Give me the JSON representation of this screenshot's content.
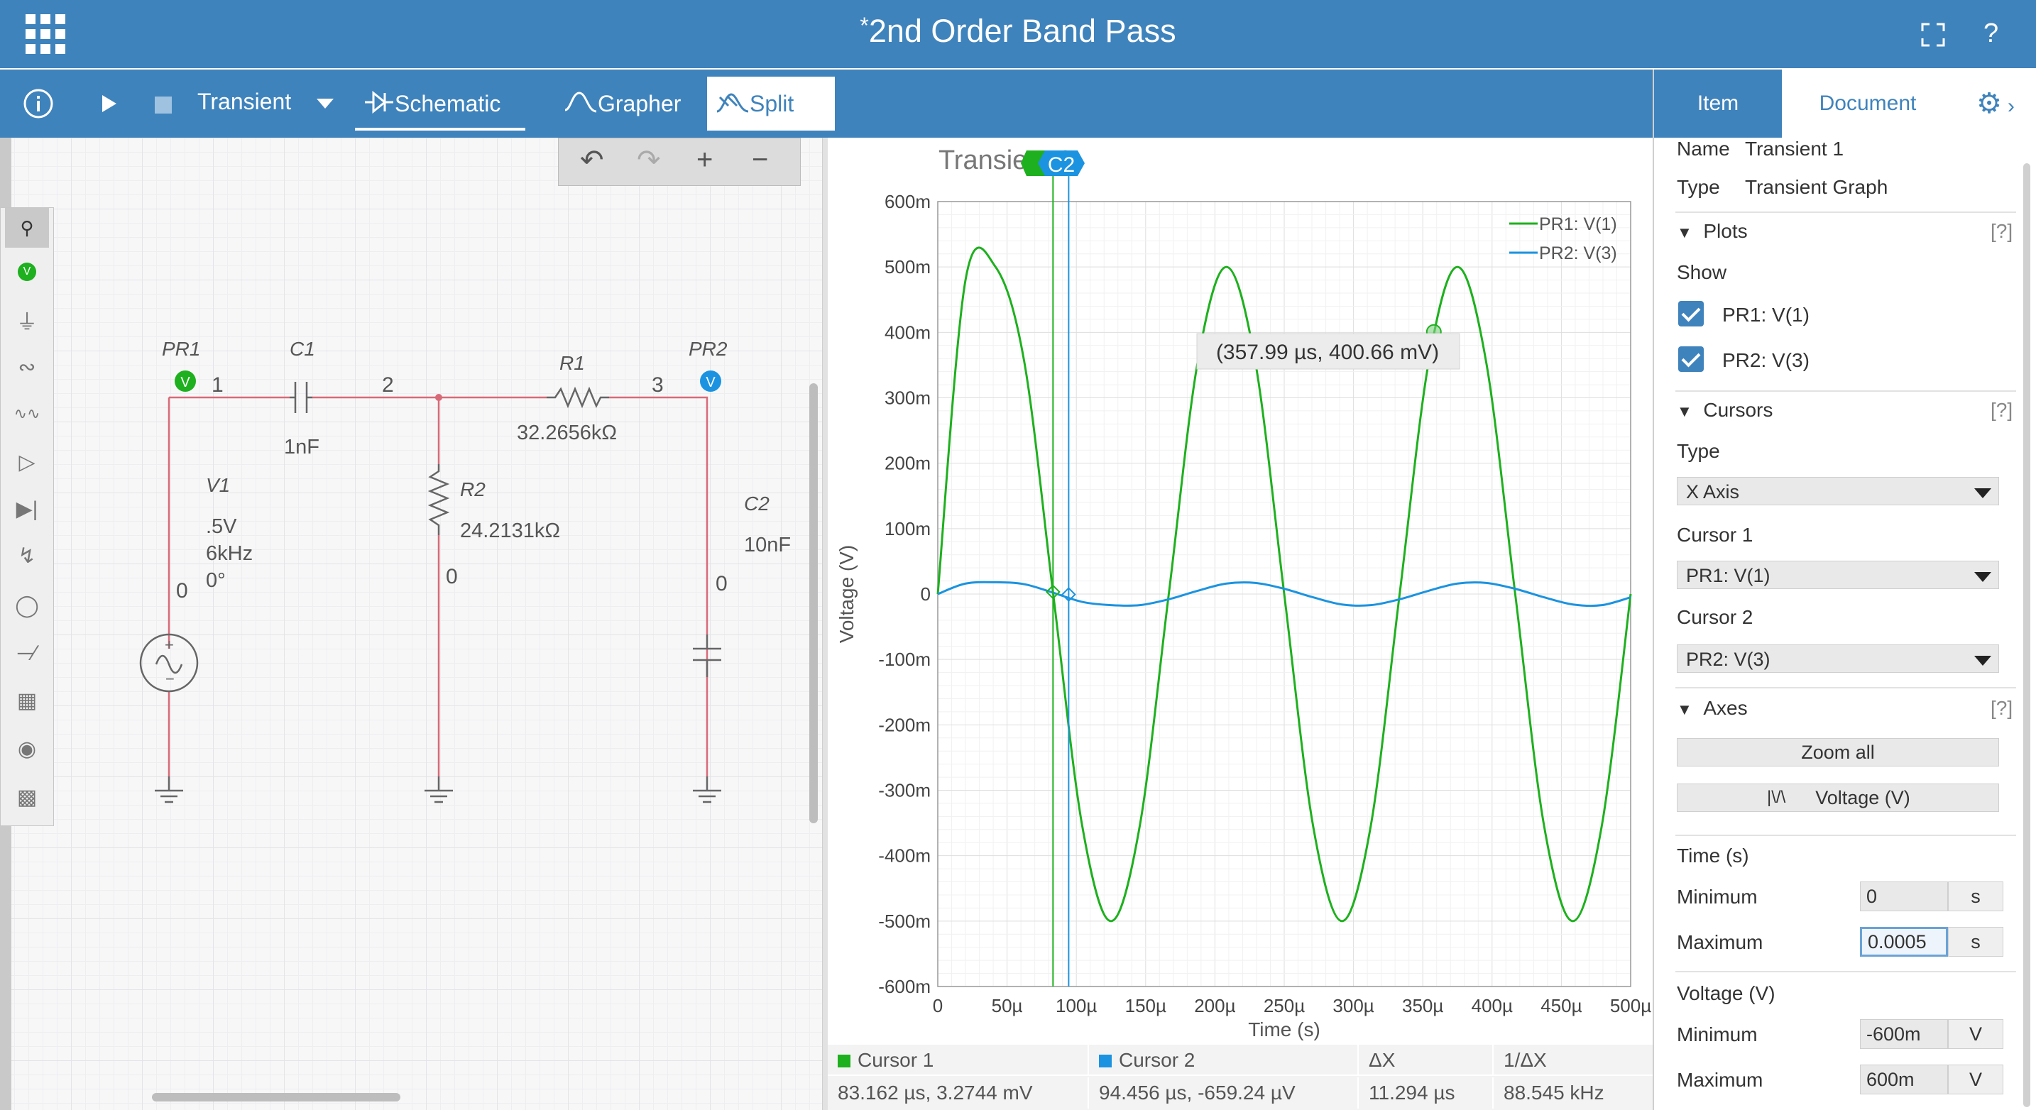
{
  "app": {
    "title": "2nd Order Band Pass",
    "modified_marker": "*"
  },
  "toolbar": {
    "analysis": "Transient",
    "tabs": [
      "Schematic",
      "Grapher",
      "Split"
    ],
    "active_tab": "Split"
  },
  "schematic": {
    "components": {
      "pr1": {
        "label": "PR1",
        "badge": "V"
      },
      "pr2": {
        "label": "PR2",
        "badge": "V"
      },
      "c1": {
        "label": "C1",
        "value": "1nF"
      },
      "r1": {
        "label": "R1",
        "value": "32.2656kΩ"
      },
      "r2": {
        "label": "R2",
        "value": "24.2131kΩ"
      },
      "c2": {
        "label": "C2",
        "value": "10nF"
      },
      "v1": {
        "label": "V1",
        "amplitude": ".5V",
        "frequency": "6kHz",
        "phase": "0°"
      }
    },
    "nodes": {
      "n1": "1",
      "n2": "2",
      "n3": "3",
      "g_v1": "0",
      "g_r2": "0",
      "g_c2": "0"
    }
  },
  "grapher": {
    "title": "Transient 1",
    "cursor_flags": [
      "C1",
      "C2"
    ],
    "tooltip": "(357.99 µs, 400.66 mV)",
    "colors": {
      "pr1": "#1eb01e",
      "pr2": "#1b93e0",
      "cursor1": "#1eb01e",
      "cursor2": "#1b93e0"
    }
  },
  "chart_data": {
    "type": "line",
    "title": "Transient 1",
    "xlabel": "Time (s)",
    "ylabel": "Voltage (V)",
    "xlim": [
      0,
      500
    ],
    "ylim": [
      -600,
      600
    ],
    "x_ticks": [
      "0",
      "50µ",
      "100µ",
      "150µ",
      "200µ",
      "250µ",
      "300µ",
      "350µ",
      "400µ",
      "450µ",
      "500µ"
    ],
    "y_ticks": [
      "600m",
      "500m",
      "400m",
      "300m",
      "200m",
      "100m",
      "0",
      "-100m",
      "-200m",
      "-300m",
      "-400m",
      "-500m",
      "-600m"
    ],
    "grid": true,
    "legend": "top-right",
    "series": [
      {
        "name": "PR1: V(1)",
        "color": "#1eb01e",
        "x": [
          0,
          20,
          41.7,
          62.5,
          83.3,
          104.2,
          125,
          145.8,
          166.7,
          187.5,
          208.3,
          229.2,
          250,
          270.8,
          291.7,
          312.5,
          333.3,
          354.2,
          375,
          395.8,
          416.7,
          437.5,
          458.3,
          479.2,
          500
        ],
        "y": [
          0,
          480,
          500,
          354,
          0,
          -354,
          -500,
          -354,
          0,
          354,
          500,
          354,
          0,
          -354,
          -500,
          -354,
          0,
          354,
          500,
          354,
          0,
          -354,
          -500,
          -354,
          0
        ]
      },
      {
        "name": "PR2: V(3)",
        "color": "#1b93e0",
        "x": [
          0,
          20,
          41.7,
          62.5,
          83.3,
          104.2,
          125,
          145.8,
          166.7,
          187.5,
          208.3,
          229.2,
          250,
          270.8,
          291.7,
          312.5,
          333.3,
          354.2,
          375,
          395.8,
          416.7,
          437.5,
          458.3,
          479.2,
          500
        ],
        "y": [
          0,
          16,
          18,
          15,
          2,
          -12,
          -17,
          -17,
          -8,
          5,
          16,
          17,
          8,
          -5,
          -16,
          -17,
          -8,
          5,
          16,
          17,
          8,
          -5,
          -16,
          -17,
          -5
        ]
      }
    ],
    "cursors": [
      {
        "name": "Cursor 1",
        "x": 83.162,
        "y": 3.2744
      },
      {
        "name": "Cursor 2",
        "x": 94.456,
        "y": -0.65924
      }
    ],
    "marker": {
      "x": 357.99,
      "y": 400.66
    }
  },
  "cursor_table": {
    "headers": [
      "Cursor 1",
      "Cursor 2",
      "ΔX",
      "1/ΔX"
    ],
    "values": [
      "83.162 µs, 3.2744 mV",
      "94.456 µs, -659.24 µV",
      "11.294 µs",
      "88.545 kHz"
    ]
  },
  "panel": {
    "tabs": [
      "Item",
      "Document"
    ],
    "active_tab": "Item",
    "name_label": "Name",
    "name_value": "Transient 1",
    "type_label": "Type",
    "type_value": "Transient Graph",
    "plots": {
      "heading": "Plots",
      "help": "[?]",
      "show_label": "Show",
      "items": [
        "PR1: V(1)",
        "PR2: V(3)"
      ]
    },
    "cursors": {
      "heading": "Cursors",
      "help": "[?]",
      "type_label": "Type",
      "type_value": "X Axis",
      "cursor1_label": "Cursor 1",
      "cursor1_value": "PR1: V(1)",
      "cursor2_label": "Cursor 2",
      "cursor2_value": "PR2: V(3)"
    },
    "axes": {
      "heading": "Axes",
      "help": "[?]",
      "zoom_all": "Zoom all",
      "voltage_btn": "Voltage (V)",
      "time_heading": "Time (s)",
      "time_min_label": "Minimum",
      "time_min": "0",
      "time_max_label": "Maximum",
      "time_max": "0.0005",
      "time_unit": "s",
      "volt_heading": "Voltage (V)",
      "volt_min_label": "Minimum",
      "volt_min": "-600m",
      "volt_max_label": "Maximum",
      "volt_max": "600m",
      "volt_unit": "V"
    }
  }
}
